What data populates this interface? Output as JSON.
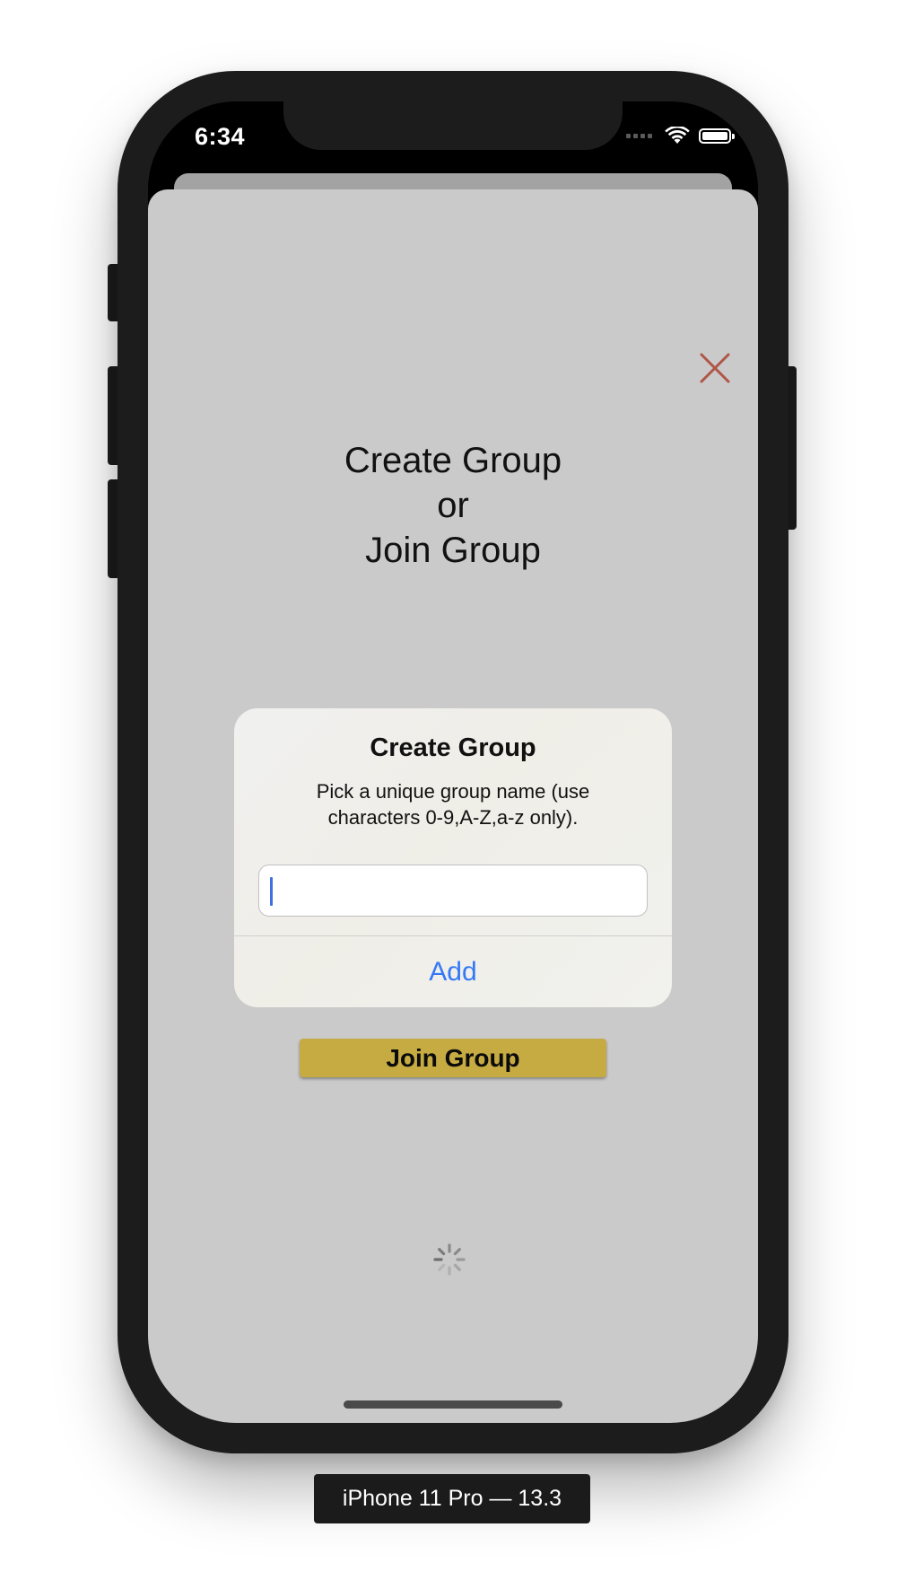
{
  "status_bar": {
    "time": "6:34"
  },
  "header": {
    "title_line1": "Create Group",
    "title_line2": "or",
    "title_line3": "Join Group"
  },
  "alert": {
    "title": "Create Group",
    "message": "Pick a unique group name (use characters 0-9,A-Z,a-z only).",
    "input_value": "",
    "input_placeholder": "",
    "add_label": "Add"
  },
  "join_button": {
    "label": "Join Group"
  },
  "device_label": "iPhone 11 Pro — 13.3",
  "icons": {
    "close": "close-icon",
    "wifi": "wifi-icon",
    "battery": "battery-icon",
    "spinner": "activity-spinner-icon"
  },
  "colors": {
    "close_icon": "#b05548",
    "join_button_bg": "#c6aa42",
    "add_button_text": "#3478f6",
    "caret": "#3f6fe0",
    "sheet_bg": "#cacaca"
  }
}
